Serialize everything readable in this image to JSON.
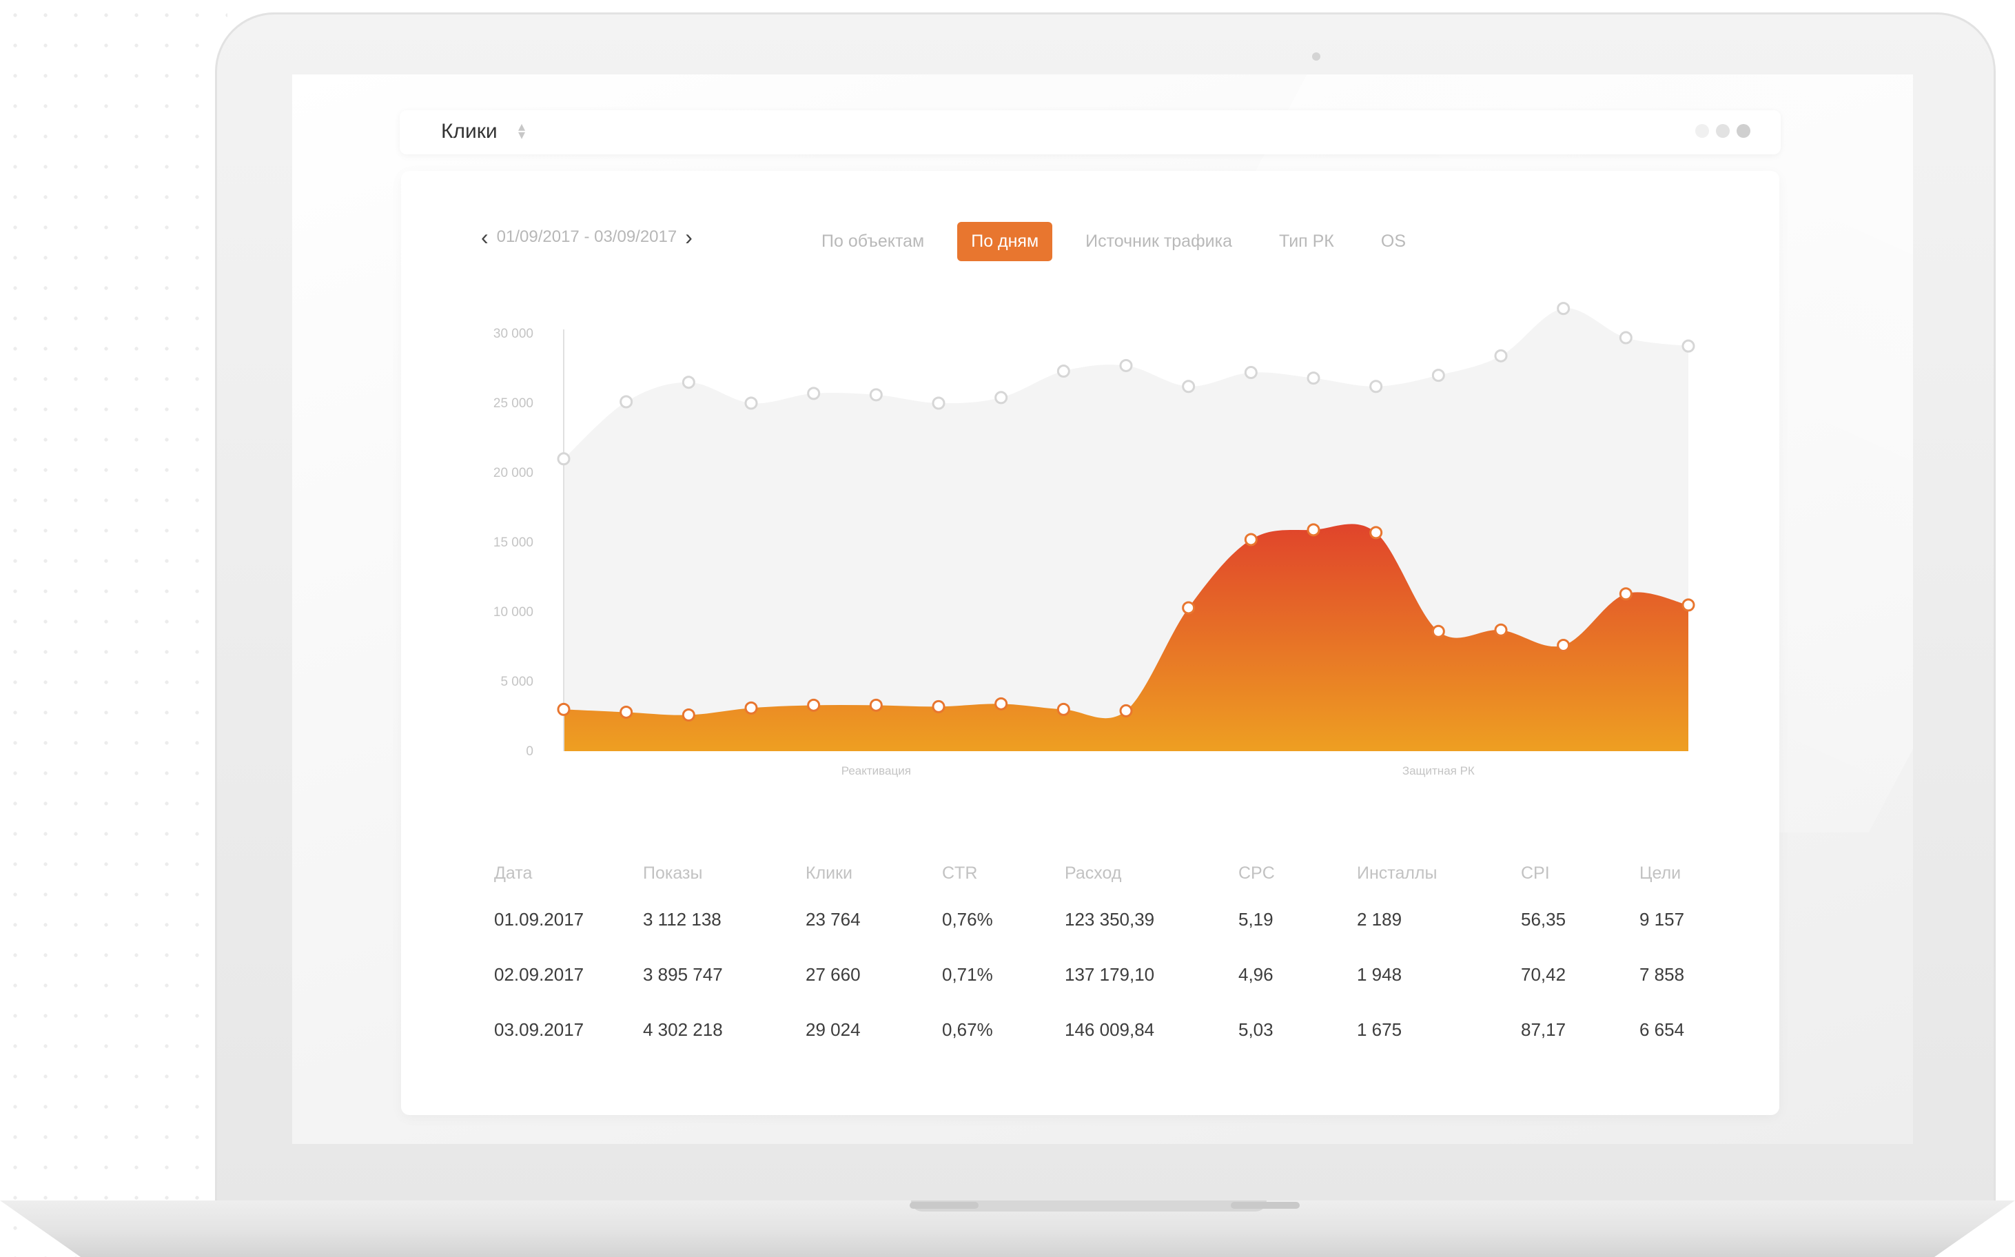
{
  "window": {
    "title": "Клики"
  },
  "filters": {
    "date_range": "01/09/2017 - 03/09/2017",
    "tabs": [
      "По объектам",
      "По дням",
      "Источник трафика",
      "Тип РК",
      "OS"
    ],
    "active_tab_index": 1
  },
  "colors": {
    "accent": "#e8762f",
    "area_top": "#e0442b",
    "area_bottom": "#ee9f22",
    "secondary_area": "#f4f4f4",
    "point_stroke_gray": "#d6d6d6"
  },
  "window_controls": [
    "dot-light",
    "dot-mid",
    "dot-dark"
  ],
  "chart_data": {
    "type": "area",
    "ylim": [
      0,
      30000
    ],
    "yticks": [
      "30 000",
      "25 000",
      "20 000",
      "15 000",
      "10 000",
      "5 000",
      "0"
    ],
    "ytick_values": [
      30000,
      25000,
      20000,
      15000,
      10000,
      5000,
      0
    ],
    "grid": false,
    "annotations": [
      {
        "label": "Реактивация",
        "x_index": 5
      },
      {
        "label": "Защитная РК",
        "x_index": 14
      }
    ],
    "x": [
      0,
      1,
      2,
      3,
      4,
      5,
      6,
      7,
      8,
      9,
      10,
      11,
      12,
      13,
      14,
      15,
      16,
      17,
      18
    ],
    "series": [
      {
        "values": [
          21000,
          25100,
          26500,
          25000,
          25700,
          25600,
          25000,
          25400,
          27300,
          27700,
          26200,
          27200,
          26800,
          26200,
          27000,
          28400,
          31800,
          29700,
          29100
        ]
      },
      {
        "values": [
          3000,
          2800,
          2600,
          3100,
          3300,
          3300,
          3200,
          3400,
          3000,
          2900,
          10300,
          15200,
          15900,
          15700,
          8600,
          8700,
          7600,
          11300,
          10500
        ]
      }
    ]
  },
  "table": {
    "headers": [
      "Дата",
      "Показы",
      "Клики",
      "CTR",
      "Расход",
      "CPC",
      "Инсталлы",
      "CPI",
      "Цели"
    ],
    "rows": [
      [
        "01.09.2017",
        "3 112 138",
        "23 764",
        "0,76%",
        "123 350,39",
        "5,19",
        "2 189",
        "56,35",
        "9 157"
      ],
      [
        "02.09.2017",
        "3 895 747",
        "27 660",
        "0,71%",
        "137 179,10",
        "4,96",
        "1 948",
        "70,42",
        "7 858"
      ],
      [
        "03.09.2017",
        "4 302 218",
        "29 024",
        "0,67%",
        "146 009,84",
        "5,03",
        "1 675",
        "87,17",
        "6 654"
      ]
    ]
  }
}
